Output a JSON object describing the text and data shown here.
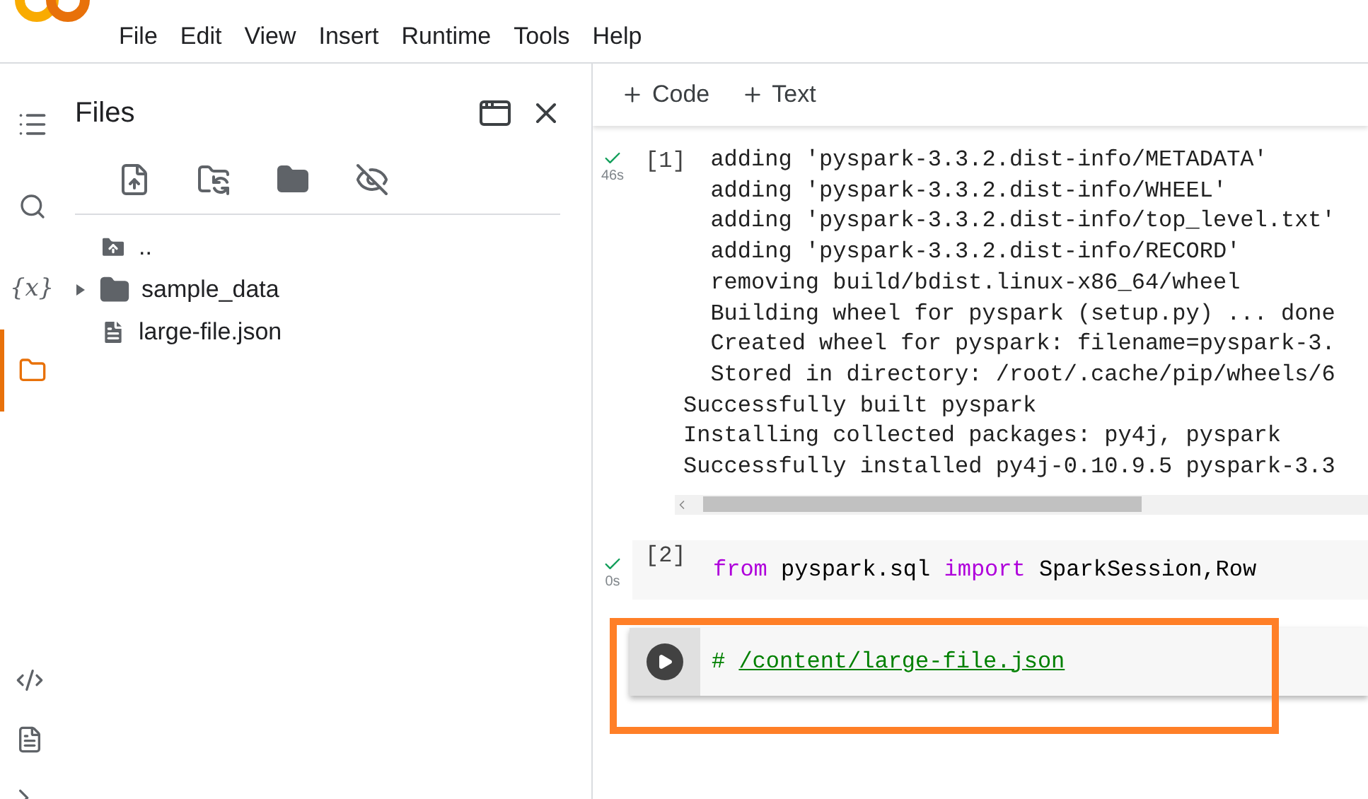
{
  "menu": [
    "File",
    "Edit",
    "View",
    "Insert",
    "Runtime",
    "Tools",
    "Help"
  ],
  "rail": {
    "variables_label": "{x}",
    "items": [
      {
        "kind": "toc",
        "selected": false
      },
      {
        "kind": "search",
        "selected": false
      },
      {
        "kind": "variables",
        "selected": false
      },
      {
        "kind": "files",
        "selected": true
      }
    ],
    "bottom": [
      {
        "kind": "code"
      },
      {
        "kind": "palette"
      },
      {
        "kind": "terminal"
      }
    ]
  },
  "files_panel": {
    "title": "Files",
    "tree": [
      {
        "kind": "up",
        "name": "..",
        "expandable": false
      },
      {
        "kind": "folder",
        "name": "sample_data",
        "expandable": true
      },
      {
        "kind": "file",
        "name": "large-file.json",
        "expandable": false
      }
    ]
  },
  "toolbar": [
    {
      "label": "Code"
    },
    {
      "label": "Text"
    }
  ],
  "cells": [
    {
      "kind": "output",
      "completed": true,
      "time": "46s",
      "count": "[1]",
      "lines": [
        {
          "text": "  adding 'pyspark-3.3.2.dist-info/METADATA'"
        },
        {
          "text": "  adding 'pyspark-3.3.2.dist-info/WHEEL'"
        },
        {
          "text": "  adding 'pyspark-3.3.2.dist-info/top_level.txt'"
        },
        {
          "text": "  adding 'pyspark-3.3.2.dist-info/RECORD'"
        },
        {
          "text": "  removing build/bdist.linux-x86_64/wheel"
        },
        {
          "text": "  Building wheel for pyspark (setup.py) ... done"
        },
        {
          "text": "  Created wheel for pyspark: filename=pyspark-3."
        },
        {
          "text": "  Stored in directory: /root/.cache/pip/wheels/6"
        },
        {
          "text": "Successfully built pyspark"
        },
        {
          "text": "Installing collected packages: py4j, pyspark"
        },
        {
          "text": "Successfully installed py4j-0.10.9.5 pyspark-3.3"
        }
      ]
    },
    {
      "kind": "code",
      "completed": true,
      "time": "0s",
      "count": "[2]",
      "tokens": [
        {
          "kind": "keyword",
          "text": "from"
        },
        {
          "kind": "plain",
          "text": " pyspark.sql "
        },
        {
          "kind": "keyword",
          "text": "import"
        },
        {
          "kind": "plain",
          "text": " SparkSession,Row"
        }
      ]
    },
    {
      "kind": "focused",
      "highlighted": true,
      "tokens": [
        {
          "kind": "comment",
          "text": "# "
        },
        {
          "kind": "link",
          "text": "/content/large-file.json"
        }
      ]
    }
  ]
}
